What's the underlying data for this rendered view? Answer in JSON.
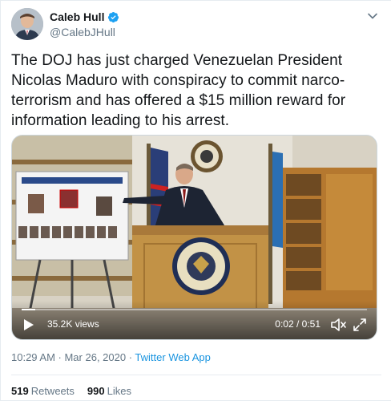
{
  "author": {
    "name": "Caleb Hull",
    "handle": "@CalebJHull",
    "verified": true
  },
  "tweet": {
    "text": "The DOJ has just charged Venezuelan President Nicolas Maduro with conspiracy to commit narco-terrorism and has offered a $15 million reward for information leading to his arrest."
  },
  "video": {
    "views": "35.2K views",
    "time": "0:02 / 0:51",
    "progress": 0.04,
    "icons": [
      "play-icon",
      "mute-icon",
      "fullscreen-icon"
    ]
  },
  "meta": {
    "timestamp": "10:29 AM · Mar 26, 2020",
    "separator": " · ",
    "app": "Twitter Web App"
  },
  "stats": {
    "retweets_count": "519",
    "retweets_label": "Retweets",
    "likes_count": "990",
    "likes_label": "Likes"
  },
  "colors": {
    "accent": "#1da1f2",
    "link": "#1b95e0",
    "secondary_text": "#657786"
  }
}
